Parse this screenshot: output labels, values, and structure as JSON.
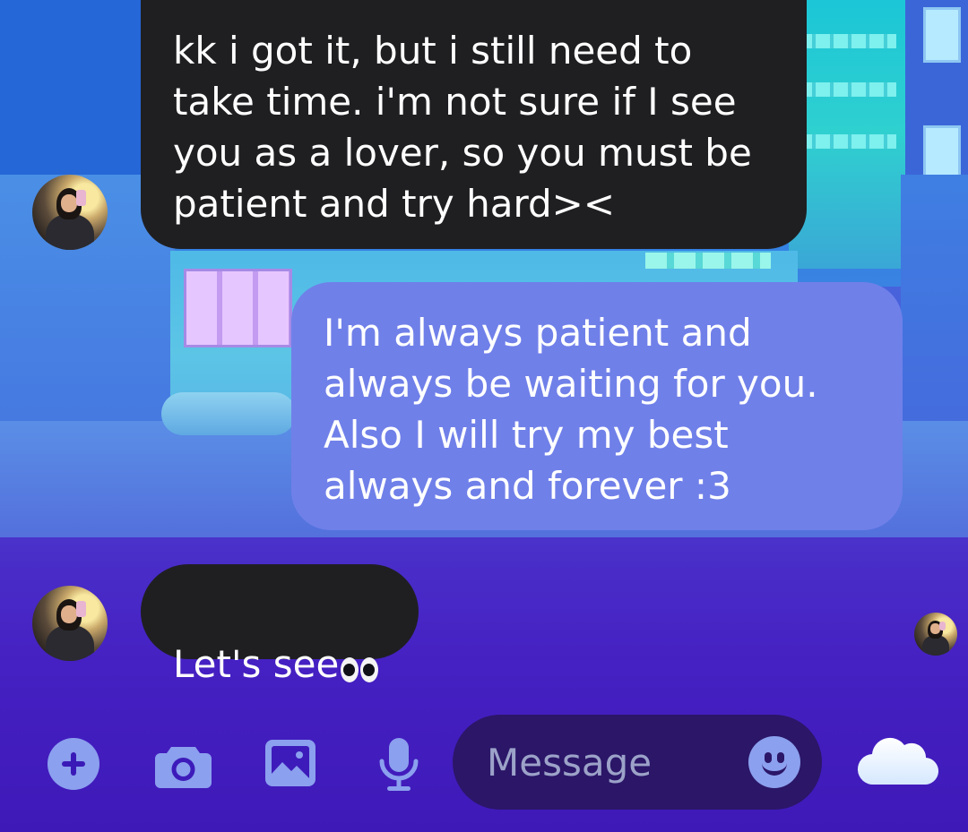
{
  "messages": [
    {
      "id": "msg1",
      "direction": "incoming",
      "text": "kk i got it, but i still need to\ntake time. i'm not sure if I see\nyou as a lover, so you must be\npatient and try hard><"
    },
    {
      "id": "msg2",
      "direction": "outgoing",
      "text": "I'm always patient and\nalways be waiting for you.\nAlso I will try my best\nalways and forever :3"
    },
    {
      "id": "msg3",
      "direction": "incoming",
      "text": "Let's see"
    }
  ],
  "composer": {
    "placeholder": "Message",
    "icons": [
      "add-icon",
      "camera-icon",
      "image-icon",
      "microphone-icon",
      "emoji-icon",
      "cloud-icon"
    ]
  },
  "colors": {
    "incoming_bubble": "#1f1f22",
    "outgoing_bubble": "#7080e9",
    "icon_accent": "#8ba0ee",
    "input_background": "#2b1668"
  }
}
